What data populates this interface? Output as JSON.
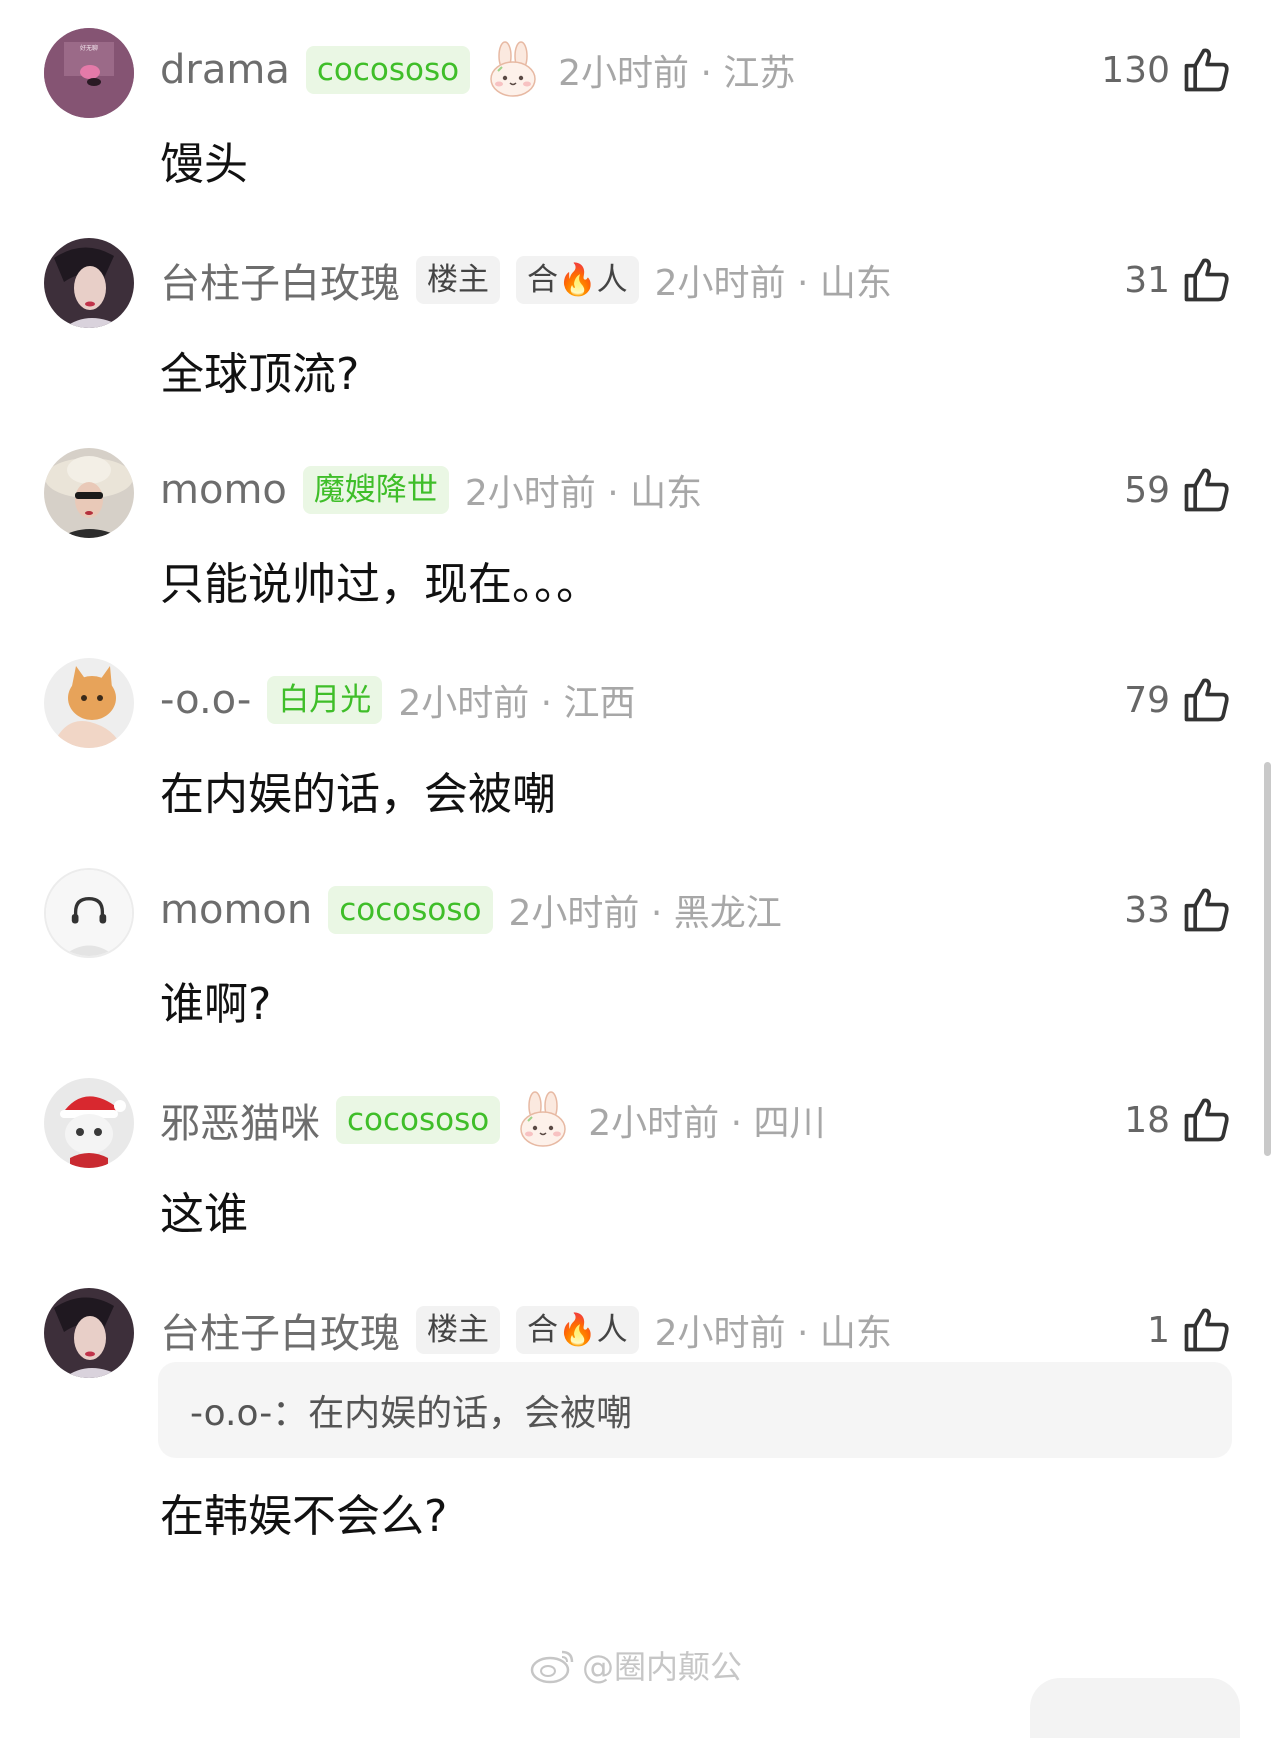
{
  "comments": [
    {
      "username": "drama",
      "badges": [
        "cocososo"
      ],
      "meta": "2小时前 · 江苏",
      "likes": "130",
      "text": "馒头",
      "avatar_text": "好无聊"
    },
    {
      "username": "台柱子白玫瑰",
      "badges": [
        "楼主",
        "合🔥人"
      ],
      "meta": "2小时前 · 山东",
      "likes": "31",
      "text": "全球顶流?"
    },
    {
      "username": "momo",
      "badges": [
        "魔嫂降世"
      ],
      "meta": "2小时前 · 山东",
      "likes": "59",
      "text": "只能说帅过，现在。。。"
    },
    {
      "username": "-o.o-",
      "badges": [
        "白月光"
      ],
      "meta": "2小时前 · 江西",
      "likes": "79",
      "text": "在内娱的话，会被嘲"
    },
    {
      "username": "momon",
      "badges": [
        "cocososo"
      ],
      "meta": "2小时前 · 黑龙江",
      "likes": "33",
      "text": "谁啊?"
    },
    {
      "username": "邪恶猫咪",
      "badges": [
        "cocososo"
      ],
      "meta": "2小时前 · 四川",
      "likes": "18",
      "text": "这谁"
    },
    {
      "username": "台柱子白玫瑰",
      "badges": [
        "楼主",
        "合🔥人"
      ],
      "meta": "2小时前 · 山东",
      "likes": "1",
      "quote": "-o.o-：在内娱的话，会被嘲",
      "text": "在韩娱不会么?"
    }
  ],
  "watermark": "@圈内颠公",
  "colors": {
    "badge_green_bg": "#eaf7e4",
    "badge_green_text": "#3fbe29",
    "meta_gray": "#a7a7a7",
    "username_gray": "#6d6d6d"
  },
  "icons": {
    "like": "thumbs-up-outline-icon",
    "sticker": "bunny-sticker-icon",
    "watermark": "weibo-logo-icon"
  }
}
